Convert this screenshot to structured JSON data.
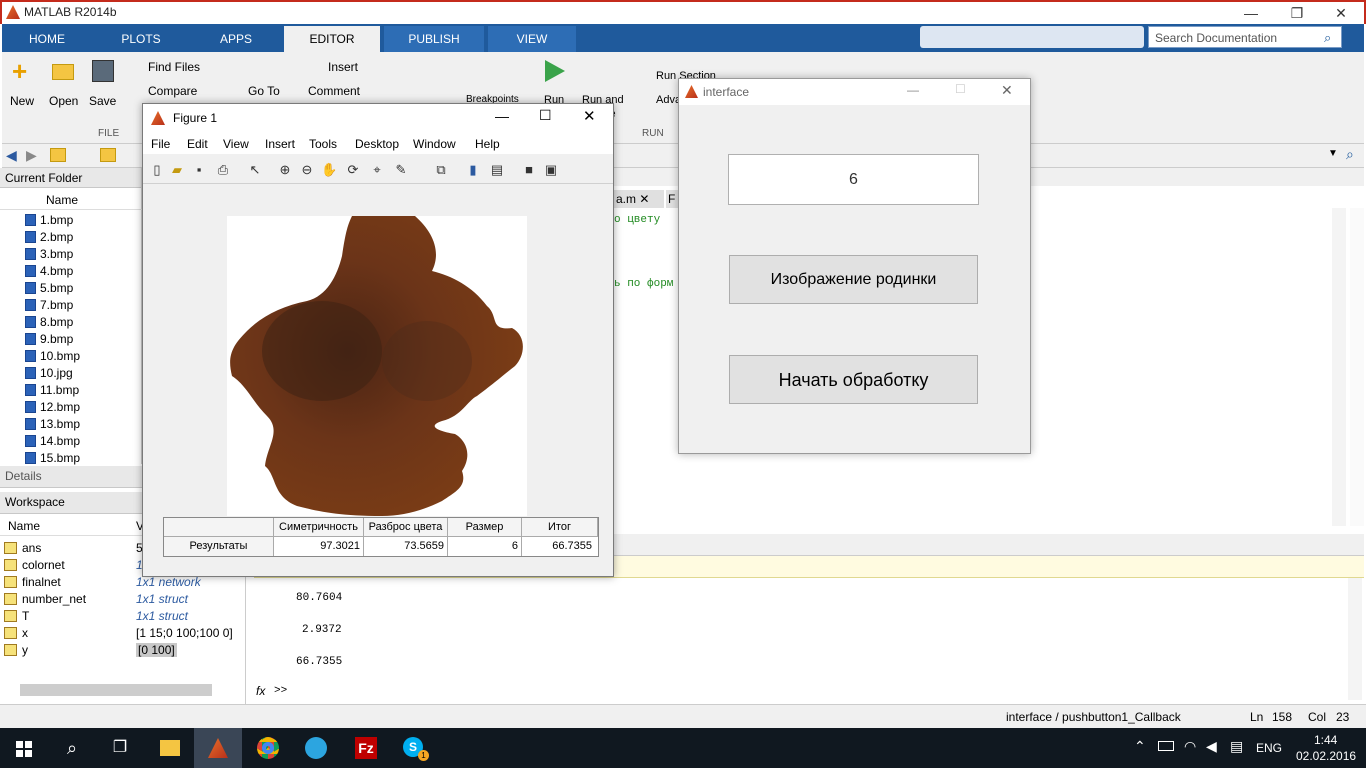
{
  "app": {
    "title": "MATLAB R2014b"
  },
  "ribbon": {
    "tabs": [
      "HOME",
      "PLOTS",
      "APPS",
      "EDITOR",
      "PUBLISH",
      "VIEW"
    ],
    "active_tab": "EDITOR",
    "search_placeholder": "Search Documentation",
    "file": {
      "new": "New",
      "open": "Open",
      "save": "Save",
      "find_files": "Find Files",
      "compare": "Compare",
      "section": "FILE"
    },
    "navigate": {
      "go_to": "Go To"
    },
    "edit": {
      "insert": "Insert",
      "comment": "Comment"
    },
    "breakpoints": "Breakpoints",
    "run": {
      "run": "Run",
      "run_and": "Run and",
      "run_section": "Run Section",
      "advance": "Adva",
      "section": "RUN",
      "ce": "ce"
    }
  },
  "current_folder": {
    "header": "Current Folder",
    "column_name": "Name",
    "files": [
      "1.bmp",
      "2.bmp",
      "3.bmp",
      "4.bmp",
      "5.bmp",
      "7.bmp",
      "8.bmp",
      "9.bmp",
      "10.bmp",
      "10.jpg",
      "11.bmp",
      "12.bmp",
      "13.bmp",
      "14.bmp",
      "15.bmp"
    ]
  },
  "details": {
    "header": "Details"
  },
  "workspace": {
    "header": "Workspace",
    "column_name": "Name",
    "column_value": "V",
    "rows": [
      {
        "name": "ans",
        "value": "5"
      },
      {
        "name": "colornet",
        "value": "1"
      },
      {
        "name": "finalnet",
        "value": "1x1 network"
      },
      {
        "name": "number_net",
        "value": "1x1 struct"
      },
      {
        "name": "T",
        "value": "1x1 struct"
      },
      {
        "name": "x",
        "value": "[1 15;0 100;100 0]"
      },
      {
        "name": "y",
        "value": "[0 100]"
      }
    ]
  },
  "editor": {
    "tabs": [
      "a.m",
      "F"
    ],
    "lines": [
      "о цвету",
      "ь по форм"
    ]
  },
  "command_window": {
    "outputs": [
      "80.7604",
      "2.9372",
      "66.7355"
    ],
    "prompt": ">>",
    "fx": "fx"
  },
  "figure1": {
    "title": "Figure 1",
    "menu": [
      "File",
      "Edit",
      "View",
      "Insert",
      "Tools",
      "Desktop",
      "Window",
      "Help"
    ],
    "table": {
      "headers": [
        "Симетричность",
        "Разброс цвета",
        "Размер",
        "Итог"
      ],
      "row_label": "Результаты",
      "values": [
        "97.3021",
        "73.5659",
        "6",
        "66.7355"
      ]
    }
  },
  "interface": {
    "title": "interface",
    "field_value": "6",
    "btn_image": "Изображение родинки",
    "btn_start": "Начать обработку"
  },
  "statusbar": {
    "function": "interface / pushbutton1_Callback",
    "ln_label": "Ln",
    "ln": "158",
    "col_label": "Col",
    "col": "23"
  },
  "taskbar": {
    "lang": "ENG",
    "time": "1:44",
    "date": "02.02.2016",
    "badge": "1"
  },
  "colors": {
    "ribbon_blue": "#1f5a9c",
    "taskbar": "#101820",
    "mole": "#5a2e17"
  }
}
